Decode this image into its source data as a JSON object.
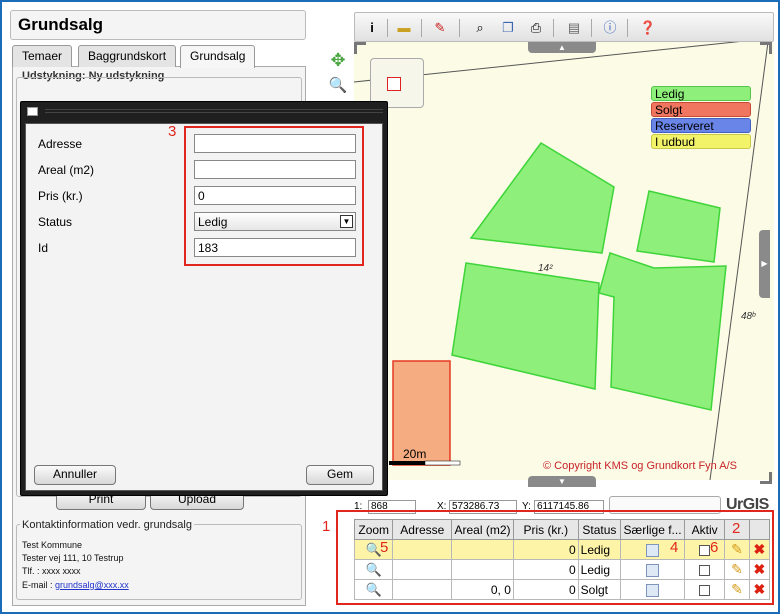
{
  "app": {
    "title": "Grundsalg"
  },
  "tabs": [
    {
      "label": "Temaer"
    },
    {
      "label": "Baggrundskort"
    },
    {
      "label": "Grundsalg"
    }
  ],
  "section": {
    "title": "Udstykning: Ny udstykning"
  },
  "left_buttons": {
    "print": "Print",
    "upload": "Upload"
  },
  "contact": {
    "title": "Kontaktinformation vedr. grundsalg",
    "name": "Test Kommune",
    "address": "Tester vej 111, 10 Testrup",
    "phone": "Tlf. : xxxx xxxx",
    "email_label": "E-mail :",
    "email": "grundsalg@xxx.xx"
  },
  "dialog": {
    "fields": [
      {
        "label": "Adresse",
        "value": ""
      },
      {
        "label": "Areal (m2)",
        "value": ""
      },
      {
        "label": "Pris (kr.)",
        "value": "0"
      },
      {
        "label": "Status",
        "value": "Ledig"
      },
      {
        "label": "Id",
        "value": "183"
      }
    ],
    "cancel": "Annuller",
    "save": "Gem"
  },
  "annotations": {
    "a1": "1",
    "a2": "2",
    "a3": "3",
    "a4": "4",
    "a5": "5",
    "a6": "6"
  },
  "legend": [
    {
      "label": "Ledig",
      "color": "#8ef07a"
    },
    {
      "label": "Solgt",
      "color": "#f0765f"
    },
    {
      "label": "Reserveret",
      "color": "#6a85e8"
    },
    {
      "label": "I udbud",
      "color": "#f3f36a"
    }
  ],
  "map": {
    "plot_labels": {
      "p1": "14²",
      "p2": "48ᵇ"
    },
    "scale_label": "20m",
    "copyright": "© Copyright KMS og Grundkort Fyn A/S",
    "logo": "UrGIS"
  },
  "coords": {
    "zoom": "1:",
    "zoom_value": "868",
    "x_label": "X:",
    "x_value": "573286.73",
    "y_label": "Y:",
    "y_value": "6117145.86"
  },
  "grid": {
    "headers": [
      "Zoom",
      "Adresse",
      "Areal (m2)",
      "Pris (kr.)",
      "Status",
      "Særlige f...",
      "Aktiv",
      "",
      ""
    ],
    "rows": [
      {
        "adresse": "",
        "areal": "",
        "pris": "0",
        "status": "Ledig"
      },
      {
        "adresse": "",
        "areal": "",
        "pris": "0",
        "status": "Ledig"
      },
      {
        "adresse": "",
        "areal": "0, 0",
        "pris": "0",
        "status": "Solgt"
      }
    ]
  },
  "colors": {
    "accent": "#1a6bb8",
    "annotation": "#e0261d",
    "plot_green": "#8ef07a",
    "plot_red": "#f4ac80"
  }
}
